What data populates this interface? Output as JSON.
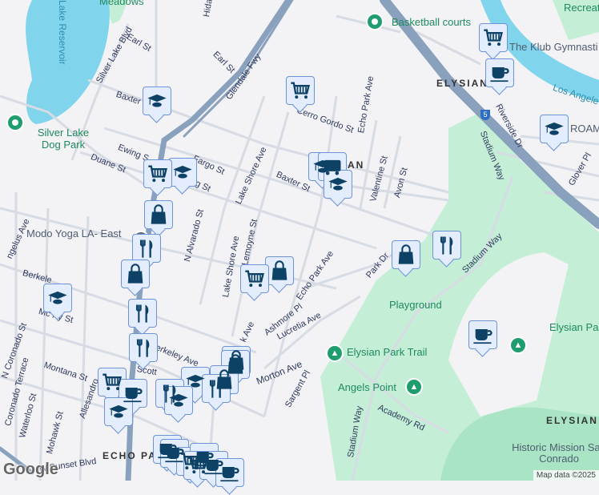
{
  "map": {
    "streets": {
      "glendale_fwy": "Glendale Fwy",
      "silver_lake_blvd": "Silver Lake Blvd",
      "earl_st_1": "Earl St",
      "earl_st_2": "Earl St",
      "hidalgo": "Hida",
      "baxter_st_1": "Baxter",
      "baxter_st_2": "Baxter St",
      "ewing_st": "Ewing S",
      "fargo_st": "Fargo St",
      "duane_st": "Duane St",
      "g_st": "g St",
      "lake_shore_ave_1": "Lake Shore Ave",
      "lake_shore_ave_2": "Lake Shore Ave",
      "cerro_gordo_st": "Cerro Gordo St",
      "echo_park_ave_1": "Echo Park Ave",
      "echo_park_ave_2": "Echo Park Ave",
      "valentine_st": "Valentine St",
      "avon_st": "Avon St",
      "riverside_dr": "Riverside Dr",
      "stadium_way_1": "Stadium Way",
      "stadium_way_2": "Stadium Way",
      "stadium_way_3": "Stadium Way",
      "glover_pl": "Glover Pl",
      "n_alvarado_st": "N Alvarado St",
      "lemoyne_st": "Lemoyne St",
      "park_dr": "Park Dr",
      "ashmore_pl": "Ashmore Pl",
      "lucretia_ave": "Lucretia Ave",
      "morton_ave": "Morton Ave",
      "berkeley_ave_1": "Berkele",
      "berkeley_ave_2": "erkeley Ave",
      "montana_st": "Montana St",
      "n_coronado_st": "N Coronado St",
      "coronado_terrace": "Coronado Terrace",
      "waterloo_st": "Waterloo St",
      "mohawk_st": "Mohawk St",
      "allesandro": "Allesandro",
      "w_sunset_blvd": "W Sunset Blvd",
      "sargent_pl": "Sargent Pl",
      "academy_rd": "Academy Rd",
      "angelus_ave": "ngelus Ave",
      "mcberry": "Mc    rry St",
      "scott": "Scott",
      "k_ave": "k Ave"
    },
    "places": {
      "meadows": "Meadows",
      "lake_reservoir": "Lake Reservoir",
      "silver_lake_dog_park": "Silver Lake Dog Park",
      "basketball_courts": "Basketball courts",
      "klub_gymnastics": "The Klub Gymnasti",
      "los_angeles_river": "Los Angele",
      "recreation": "Recreat",
      "roam": "ROAM",
      "modo_yoga": "Modo Yoga LA- East",
      "playground": "Playground",
      "elysian_park_trail": "Elysian Park Trail",
      "angels_point": "Angels Point",
      "elysian_park": "Elysian Pa",
      "historic_mission": "Historic Mission San Conrado"
    },
    "areas": {
      "elysian_valley": "ELYSIAN    LEY",
      "echo_park": "ECHO PA",
      "elysian_park": "ELYSIAN",
      "partial_an": "AN"
    },
    "highway_shield": "5",
    "attribution": "Map data ©2025",
    "logo": "Google"
  },
  "colors": {
    "marker_bg": "#e4edfd",
    "marker_border": "#6d93d8",
    "marker_icon": "#0d4266",
    "park": "#c4efd6",
    "water": "#80d4ec",
    "freeway": "#8aa1be"
  }
}
